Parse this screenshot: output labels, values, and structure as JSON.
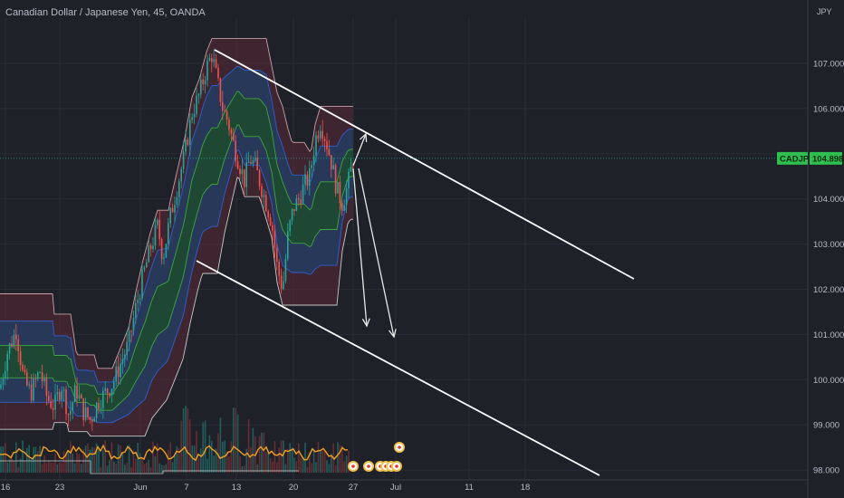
{
  "title": "Canadian Dollar / Japanese Yen, 45, OANDA",
  "currency": "JPY",
  "symbol": "CADJPY",
  "last_price": "104.898",
  "colors": {
    "background": "#1f2129",
    "channel_line": "#ffffff",
    "price_label_bg": "#26a69a",
    "candle_up": "#26a69a",
    "candle_down": "#ef5350",
    "band_outer": "#5a2a36",
    "band_middle": "#243c60",
    "band_inner": "#1d4a30",
    "band_line_red": "#ef5350",
    "band_line_blue": "#2f5fd0",
    "band_line_green": "#3fa53f",
    "oscillator": "#f0a020"
  },
  "chart_data": {
    "type": "candlestick",
    "title": "Canadian Dollar / Japanese Yen, 45, OANDA",
    "y_axis": {
      "unit": "JPY",
      "ticks": [
        "107.000",
        "106.000",
        "105.000",
        "104.000",
        "103.000",
        "102.000",
        "101.000",
        "100.000",
        "99.000",
        "98.000"
      ],
      "range": [
        97.9,
        107.6
      ]
    },
    "x_axis": {
      "ticks": [
        "16",
        "23",
        "Jun",
        "7",
        "13",
        "20",
        "27",
        "Jul",
        "11",
        "18"
      ]
    },
    "current_price": 104.898,
    "price_path": [
      [
        0,
        99.8
      ],
      [
        8,
        100.6
      ],
      [
        18,
        101.1
      ],
      [
        26,
        100.0
      ],
      [
        34,
        99.7
      ],
      [
        44,
        100.2
      ],
      [
        52,
        99.6
      ],
      [
        60,
        99.4
      ],
      [
        68,
        99.9
      ],
      [
        76,
        99.2
      ],
      [
        84,
        99.8
      ],
      [
        92,
        99.3
      ],
      [
        100,
        99.1
      ],
      [
        108,
        99.5
      ],
      [
        116,
        99.7
      ],
      [
        124,
        99.9
      ],
      [
        134,
        100.4
      ],
      [
        142,
        100.8
      ],
      [
        150,
        101.6
      ],
      [
        158,
        102.3
      ],
      [
        166,
        102.9
      ],
      [
        174,
        103.4
      ],
      [
        180,
        102.7
      ],
      [
        188,
        103.6
      ],
      [
        196,
        104.3
      ],
      [
        204,
        105.0
      ],
      [
        212,
        105.9
      ],
      [
        220,
        106.3
      ],
      [
        228,
        106.9
      ],
      [
        234,
        107.2
      ],
      [
        240,
        106.6
      ],
      [
        246,
        106.0
      ],
      [
        252,
        105.7
      ],
      [
        258,
        105.2
      ],
      [
        264,
        104.8
      ],
      [
        270,
        104.4
      ],
      [
        276,
        104.9
      ],
      [
        282,
        104.7
      ],
      [
        288,
        104.3
      ],
      [
        294,
        103.9
      ],
      [
        300,
        103.5
      ],
      [
        306,
        102.5
      ],
      [
        312,
        102.0
      ],
      [
        318,
        103.2
      ],
      [
        324,
        103.8
      ],
      [
        330,
        104.0
      ],
      [
        336,
        104.3
      ],
      [
        342,
        104.5
      ],
      [
        348,
        105.3
      ],
      [
        354,
        105.7
      ],
      [
        360,
        105.3
      ],
      [
        366,
        104.8
      ],
      [
        372,
        104.2
      ],
      [
        378,
        103.9
      ],
      [
        384,
        104.3
      ],
      [
        390,
        104.9
      ]
    ],
    "channel_upper": {
      "from": [
        "May 30",
        107.5
      ],
      "to": [
        "Jul 22",
        103.3
      ]
    },
    "channel_lower": {
      "from": [
        "Jun 3",
        102.7
      ],
      "to": [
        "Jul 25",
        98.0
      ]
    },
    "projection_arrows": [
      {
        "from": 104.898,
        "to": 105.4
      },
      {
        "from": 104.7,
        "to": 101.0
      },
      {
        "from": 104.5,
        "to": 100.6
      }
    ]
  }
}
